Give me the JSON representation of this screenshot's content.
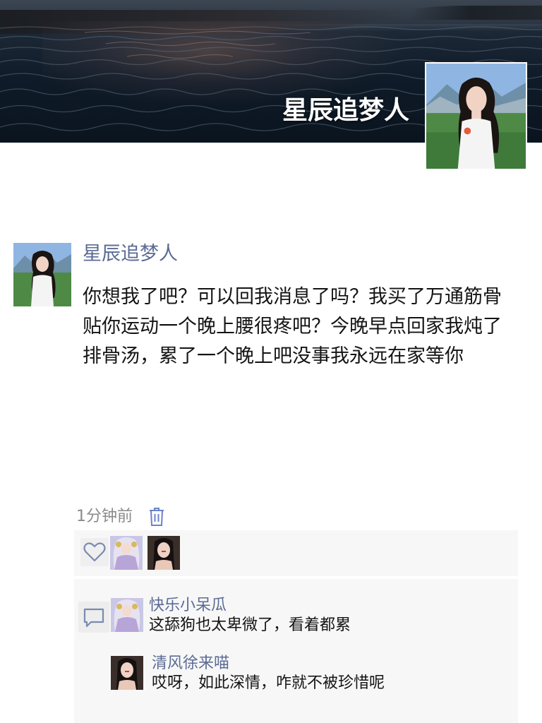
{
  "profile": {
    "name": "星辰追梦人"
  },
  "post": {
    "author": "星辰追梦人",
    "content": "你想我了吧？可以回我消息了吗？我买了万通筋骨贴你运动一个晚上腰很疼吧？今晚早点回家我炖了排骨汤，累了一个晚上吧没事我永远在家等你",
    "time": "1分钟前"
  },
  "likes": {
    "icon": "heart-icon"
  },
  "comments": [
    {
      "user": "快乐小呆瓜",
      "text": "这舔狗也太卑微了，看着都累"
    },
    {
      "user": "清风徐来喵",
      "text": "哎呀，如此深情，咋就不被珍惜呢"
    }
  ],
  "colors": {
    "link": "#5b6b94",
    "accent_icon": "#6a82c9",
    "panel": "#f7f7f7"
  }
}
